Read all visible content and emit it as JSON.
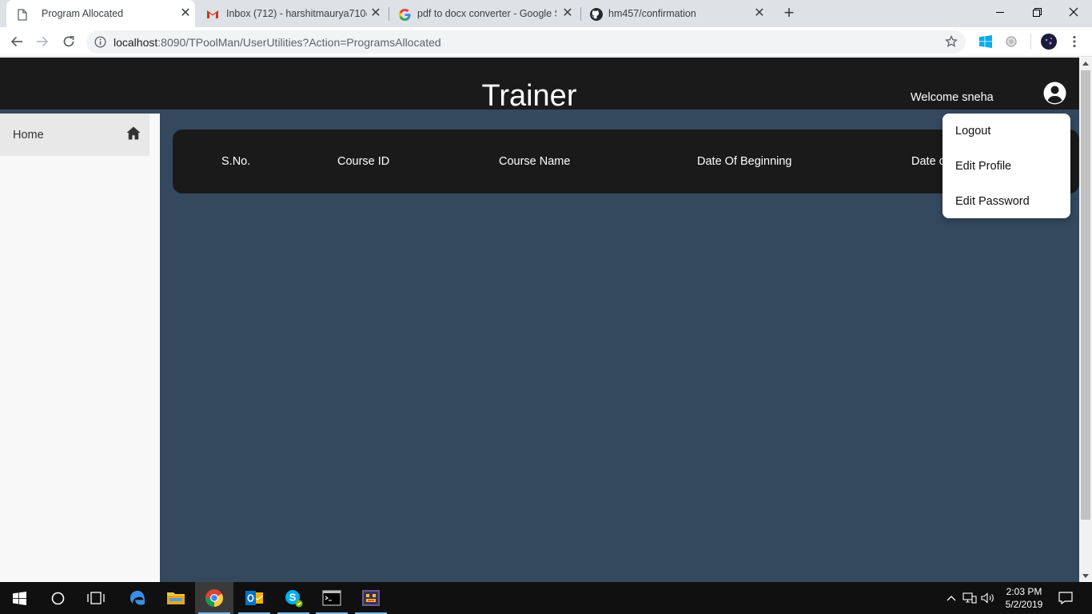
{
  "browser": {
    "tabs": [
      {
        "title": "Program Allocated",
        "icon": "page-icon",
        "active": true
      },
      {
        "title": "Inbox (712) - harshitmaurya710@",
        "icon": "gmail-icon",
        "active": false
      },
      {
        "title": "pdf to docx converter - Google S",
        "icon": "google-icon",
        "active": false
      },
      {
        "title": "hm457/confirmation",
        "icon": "github-icon",
        "active": false
      }
    ],
    "url_host": "localhost",
    "url_path": ":8090/TPoolMan/UserUtilities?Action=ProgramsAllocated"
  },
  "header": {
    "title": "Trainer",
    "welcome": "Welcome sneha"
  },
  "sidebar": {
    "items": [
      {
        "label": "Home",
        "icon": "home-icon"
      }
    ]
  },
  "table": {
    "columns": [
      "S.No.",
      "Course ID",
      "Course Name",
      "Date Of Beginning",
      "Date of Completion"
    ],
    "rows": []
  },
  "user_menu": {
    "items": [
      "Logout",
      "Edit Profile",
      "Edit Password"
    ]
  },
  "taskbar": {
    "time": "2:03 PM",
    "date": "5/2/2019"
  },
  "colors": {
    "page_bg": "#34495e",
    "header_bg": "#1a1a1a",
    "sidebar_bg": "#f8f8f8"
  }
}
